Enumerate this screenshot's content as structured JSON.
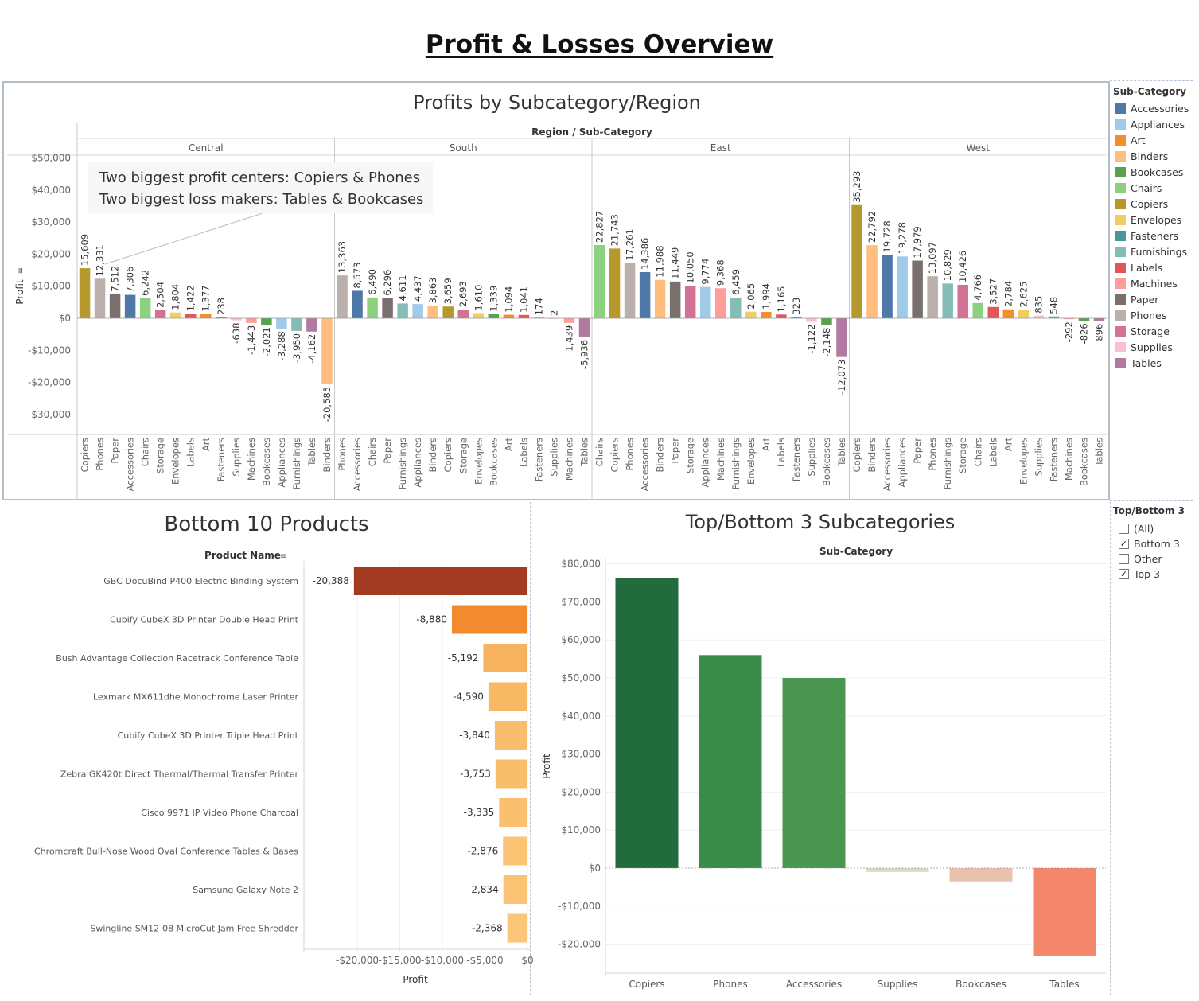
{
  "dashboard": {
    "title": "Profit & Losses Overview"
  },
  "colors": {
    "Accessories": "#4e79a7",
    "Appliances": "#a0cbe8",
    "Art": "#f28e2b",
    "Binders": "#ffbe7d",
    "Bookcases": "#59a14f",
    "Chairs": "#8cd17d",
    "Copiers": "#b6992d",
    "Envelopes": "#f1ce63",
    "Fasteners": "#499894",
    "Furnishings": "#86bcb6",
    "Labels": "#e15759",
    "Machines": "#ff9d9a",
    "Paper": "#79706e",
    "Phones": "#bab0ac",
    "Storage": "#d37295",
    "Supplies": "#fabfd2",
    "Tables": "#b07aa1"
  },
  "legend": {
    "title": "Sub-Category",
    "items": [
      "Accessories",
      "Appliances",
      "Art",
      "Binders",
      "Bookcases",
      "Chairs",
      "Copiers",
      "Envelopes",
      "Fasteners",
      "Furnishings",
      "Labels",
      "Machines",
      "Paper",
      "Phones",
      "Storage",
      "Supplies",
      "Tables"
    ]
  },
  "filter": {
    "title": "Top/Bottom 3",
    "options": [
      {
        "label": "(All)",
        "checked": false
      },
      {
        "label": "Bottom 3",
        "checked": true
      },
      {
        "label": "Other",
        "checked": false
      },
      {
        "label": "Top 3",
        "checked": true
      }
    ]
  },
  "annotation": {
    "line1": "Two biggest profit centers: Copiers & Phones",
    "line2": "Two biggest loss makers: Tables & Bookcases"
  },
  "chart_data": [
    {
      "type": "bar",
      "title": "Profits by Subcategory/Region",
      "column_header": "Region / Sub-Category",
      "ylabel": "Profit",
      "ylim": [
        -36000,
        53000
      ],
      "yticks": [
        50000,
        40000,
        30000,
        20000,
        10000,
        0,
        -10000,
        -20000,
        -30000
      ],
      "ytick_labels": [
        "$50,000",
        "$40,000",
        "$30,000",
        "$20,000",
        "$10,000",
        "$0",
        "-$10,000",
        "-$20,000",
        "-$30,000"
      ],
      "panels": [
        {
          "region": "Central",
          "bars": [
            {
              "cat": "Copiers",
              "value": 15609,
              "label": "15,609"
            },
            {
              "cat": "Phones",
              "value": 12331,
              "label": "12,331"
            },
            {
              "cat": "Paper",
              "value": 7512,
              "label": "7,512"
            },
            {
              "cat": "Accessories",
              "value": 7306,
              "label": "7,306"
            },
            {
              "cat": "Chairs",
              "value": 6242,
              "label": "6,242"
            },
            {
              "cat": "Storage",
              "value": 2504,
              "label": "2,504"
            },
            {
              "cat": "Envelopes",
              "value": 1804,
              "label": "1,804"
            },
            {
              "cat": "Labels",
              "value": 1422,
              "label": "1,422"
            },
            {
              "cat": "Art",
              "value": 1377,
              "label": "1,377"
            },
            {
              "cat": "Fasteners",
              "value": 238,
              "label": "238"
            },
            {
              "cat": "Supplies",
              "value": -638,
              "label": "-638"
            },
            {
              "cat": "Machines",
              "value": -1443,
              "label": "-1,443"
            },
            {
              "cat": "Bookcases",
              "value": -2021,
              "label": "-2,021"
            },
            {
              "cat": "Appliances",
              "value": -3288,
              "label": "-3,288"
            },
            {
              "cat": "Furnishings",
              "value": -3950,
              "label": "-3,950"
            },
            {
              "cat": "Tables",
              "value": -4162,
              "label": "-4,162"
            },
            {
              "cat": "Binders",
              "value": -20585,
              "label": "-20,585"
            }
          ]
        },
        {
          "region": "South",
          "bars": [
            {
              "cat": "Phones",
              "value": 13363,
              "label": "13,363"
            },
            {
              "cat": "Accessories",
              "value": 8573,
              "label": "8,573"
            },
            {
              "cat": "Chairs",
              "value": 6490,
              "label": "6,490"
            },
            {
              "cat": "Paper",
              "value": 6296,
              "label": "6,296"
            },
            {
              "cat": "Furnishings",
              "value": 4611,
              "label": "4,611"
            },
            {
              "cat": "Appliances",
              "value": 4437,
              "label": "4,437"
            },
            {
              "cat": "Binders",
              "value": 3863,
              "label": "3,863"
            },
            {
              "cat": "Copiers",
              "value": 3659,
              "label": "3,659"
            },
            {
              "cat": "Storage",
              "value": 2693,
              "label": "2,693"
            },
            {
              "cat": "Envelopes",
              "value": 1610,
              "label": "1,610"
            },
            {
              "cat": "Bookcases",
              "value": 1339,
              "label": "1,339"
            },
            {
              "cat": "Art",
              "value": 1094,
              "label": "1,094"
            },
            {
              "cat": "Labels",
              "value": 1041,
              "label": "1,041"
            },
            {
              "cat": "Fasteners",
              "value": 174,
              "label": "174"
            },
            {
              "cat": "Supplies",
              "value": 2,
              "label": "2"
            },
            {
              "cat": "Machines",
              "value": -1439,
              "label": "-1,439"
            },
            {
              "cat": "Tables",
              "value": -5936,
              "label": "-5,936"
            }
          ]
        },
        {
          "region": "East",
          "bars": [
            {
              "cat": "Chairs",
              "value": 22827,
              "label": "22,827"
            },
            {
              "cat": "Copiers",
              "value": 21743,
              "label": "21,743"
            },
            {
              "cat": "Phones",
              "value": 17261,
              "label": "17,261"
            },
            {
              "cat": "Accessories",
              "value": 14386,
              "label": "14,386"
            },
            {
              "cat": "Binders",
              "value": 11988,
              "label": "11,988"
            },
            {
              "cat": "Paper",
              "value": 11449,
              "label": "11,449"
            },
            {
              "cat": "Storage",
              "value": 10050,
              "label": "10,050"
            },
            {
              "cat": "Appliances",
              "value": 9774,
              "label": "9,774"
            },
            {
              "cat": "Machines",
              "value": 9368,
              "label": "9,368"
            },
            {
              "cat": "Furnishings",
              "value": 6459,
              "label": "6,459"
            },
            {
              "cat": "Envelopes",
              "value": 2065,
              "label": "2,065"
            },
            {
              "cat": "Art",
              "value": 1994,
              "label": "1,994"
            },
            {
              "cat": "Labels",
              "value": 1165,
              "label": "1,165"
            },
            {
              "cat": "Fasteners",
              "value": 323,
              "label": "323"
            },
            {
              "cat": "Supplies",
              "value": -1122,
              "label": "-1,122"
            },
            {
              "cat": "Bookcases",
              "value": -2148,
              "label": "-2,148"
            },
            {
              "cat": "Tables",
              "value": -12073,
              "label": "-12,073"
            }
          ]
        },
        {
          "region": "West",
          "bars": [
            {
              "cat": "Copiers",
              "value": 35293,
              "label": "35,293"
            },
            {
              "cat": "Binders",
              "value": 22792,
              "label": "22,792"
            },
            {
              "cat": "Accessories",
              "value": 19728,
              "label": "19,728"
            },
            {
              "cat": "Appliances",
              "value": 19278,
              "label": "19,278"
            },
            {
              "cat": "Paper",
              "value": 17979,
              "label": "17,979"
            },
            {
              "cat": "Phones",
              "value": 13097,
              "label": "13,097"
            },
            {
              "cat": "Furnishings",
              "value": 10829,
              "label": "10,829"
            },
            {
              "cat": "Storage",
              "value": 10426,
              "label": "10,426"
            },
            {
              "cat": "Chairs",
              "value": 4766,
              "label": "4,766"
            },
            {
              "cat": "Labels",
              "value": 3527,
              "label": "3,527"
            },
            {
              "cat": "Art",
              "value": 2784,
              "label": "2,784"
            },
            {
              "cat": "Envelopes",
              "value": 2625,
              "label": "2,625"
            },
            {
              "cat": "Supplies",
              "value": 835,
              "label": "835"
            },
            {
              "cat": "Fasteners",
              "value": 548,
              "label": "548"
            },
            {
              "cat": "Machines",
              "value": -292,
              "label": "-292"
            },
            {
              "cat": "Bookcases",
              "value": -826,
              "label": "-826"
            },
            {
              "cat": "Tables",
              "value": -896,
              "label": "-896"
            }
          ]
        }
      ]
    },
    {
      "type": "bar",
      "orientation": "horizontal",
      "title": "Bottom 10 Products",
      "row_header": "Product Name",
      "xlabel": "Profit",
      "xlim": [
        -23000,
        400
      ],
      "xticks": [
        -20000,
        -15000,
        -10000,
        -5000,
        0
      ],
      "xtick_labels": [
        "-$20,000",
        "-$15,000",
        "-$10,000",
        "-$5,000",
        "$0"
      ],
      "bars": [
        {
          "product": "GBC DocuBind P400 Electric Binding System",
          "value": -20388,
          "label": "-20,388",
          "color": "#a23b22"
        },
        {
          "product": "Cubify CubeX 3D Printer Double Head Print",
          "value": -8880,
          "label": "-8,880",
          "color": "#f28a30"
        },
        {
          "product": "Bush Advantage Collection Racetrack Conference Table",
          "value": -5192,
          "label": "-5,192",
          "color": "#f7b25f"
        },
        {
          "product": "Lexmark MX611dhe Monochrome Laser Printer",
          "value": -4590,
          "label": "-4,590",
          "color": "#f8b965"
        },
        {
          "product": "Cubify CubeX 3D Printer Triple Head Print",
          "value": -3840,
          "label": "-3,840",
          "color": "#f9bd6b"
        },
        {
          "product": "Zebra GK420t Direct Thermal/Thermal Transfer Printer",
          "value": -3753,
          "label": "-3,753",
          "color": "#f9be6c"
        },
        {
          "product": "Cisco 9971 IP Video Phone Charcoal",
          "value": -3335,
          "label": "-3,335",
          "color": "#fac070"
        },
        {
          "product": "Chromcraft Bull-Nose Wood Oval Conference Tables & Bases",
          "value": -2876,
          "label": "-2,876",
          "color": "#fbc374"
        },
        {
          "product": "Samsung Galaxy Note 2",
          "value": -2834,
          "label": "-2,834",
          "color": "#fbc374"
        },
        {
          "product": "Swingline SM12-08 MicroCut Jam Free Shredder",
          "value": -2368,
          "label": "-2,368",
          "color": "#fcc67a"
        }
      ]
    },
    {
      "type": "bar",
      "title": "Top/Bottom 3 Subcategories",
      "column_header": "Sub-Category",
      "ylabel": "Profit",
      "ylim": [
        -28000,
        83000
      ],
      "yticks": [
        80000,
        70000,
        60000,
        50000,
        40000,
        30000,
        20000,
        10000,
        0,
        -10000,
        -20000
      ],
      "ytick_labels": [
        "$80,000",
        "$70,000",
        "$60,000",
        "$50,000",
        "$40,000",
        "$30,000",
        "$20,000",
        "$10,000",
        "$0",
        "-$10,000",
        "-$20,000"
      ],
      "categories": [
        "Copiers",
        "Phones",
        "Accessories",
        "Supplies",
        "Bookcases",
        "Tables"
      ],
      "values": [
        76300,
        56000,
        50000,
        -1000,
        -3500,
        -23000
      ],
      "bar_colors": [
        "#226b3c",
        "#3a8c4b",
        "#4a9651",
        "#d9d8c2",
        "#e8c2ac",
        "#f4866c"
      ]
    }
  ]
}
